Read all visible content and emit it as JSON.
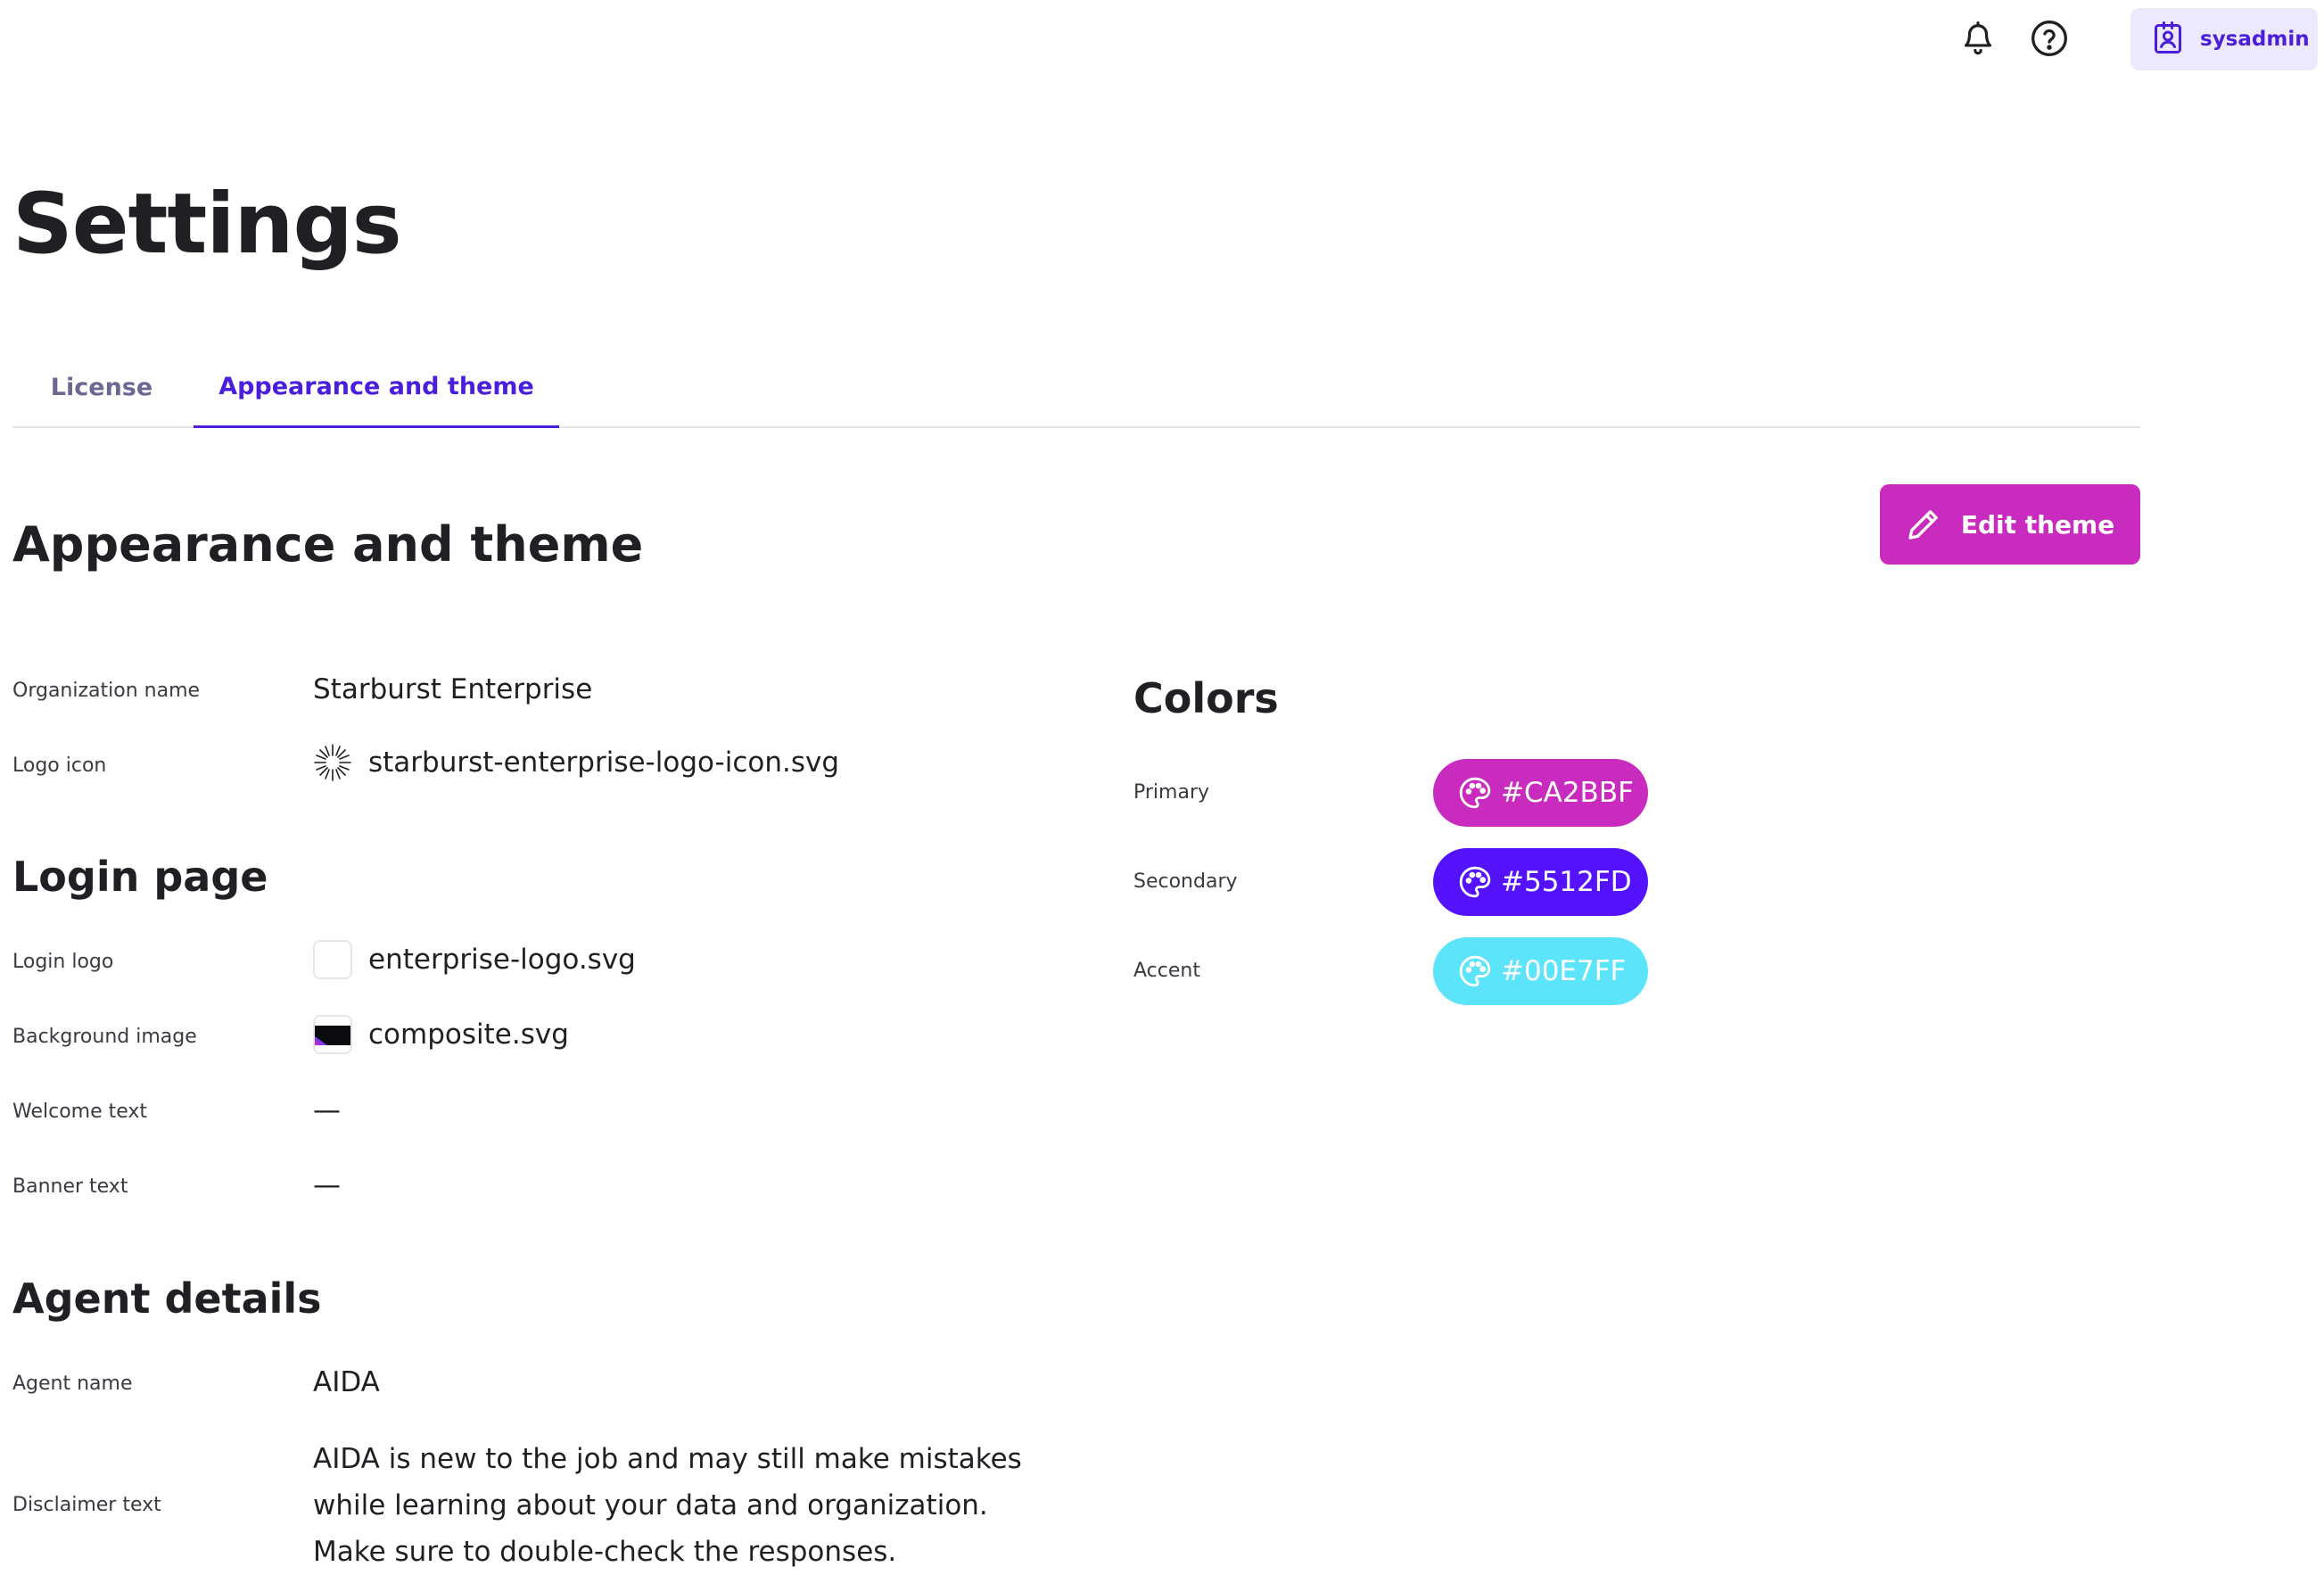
{
  "header": {
    "notifications_icon": "bell-icon",
    "help_icon": "help-circle-icon",
    "user": {
      "icon": "user-badge-icon",
      "name": "sysadmin"
    }
  },
  "page": {
    "title": "Settings"
  },
  "tabs": [
    {
      "label": "License",
      "active": false
    },
    {
      "label": "Appearance and theme",
      "active": true
    }
  ],
  "section": {
    "title": "Appearance and theme",
    "edit_button": {
      "label": "Edit theme",
      "icon": "pencil-icon"
    }
  },
  "general": {
    "organization_name": {
      "label": "Organization name",
      "value": "Starburst Enterprise"
    },
    "logo_icon": {
      "label": "Logo icon",
      "value": "starburst-enterprise-logo-icon.svg",
      "icon": "starburst-logo-icon"
    }
  },
  "login_page": {
    "title": "Login page",
    "login_logo": {
      "label": "Login logo",
      "value": "enterprise-logo.svg"
    },
    "background_image": {
      "label": "Background image",
      "value": "composite.svg"
    },
    "welcome_text": {
      "label": "Welcome text",
      "value": "—"
    },
    "banner_text": {
      "label": "Banner text",
      "value": "—"
    }
  },
  "agent_details": {
    "title": "Agent details",
    "agent_name": {
      "label": "Agent name",
      "value": "AIDA"
    },
    "disclaimer": {
      "label": "Disclaimer text",
      "value": "AIDA is new to the job and may still make mistakes while learning about your data and organization. Make sure to double-check the responses."
    }
  },
  "colors": {
    "title": "Colors",
    "items": [
      {
        "label": "Primary",
        "value": "#CA2BBF",
        "hex": "#CA2BBF",
        "icon": "palette-icon"
      },
      {
        "label": "Secondary",
        "value": "#5512FD",
        "hex": "#5512FD",
        "icon": "palette-icon"
      },
      {
        "label": "Accent",
        "value": "#00E7FF",
        "hex": "#5CE4FB",
        "icon": "palette-icon"
      }
    ]
  },
  "theme": {
    "accent": "#4B1EDB",
    "button": "#CA2BBF"
  }
}
